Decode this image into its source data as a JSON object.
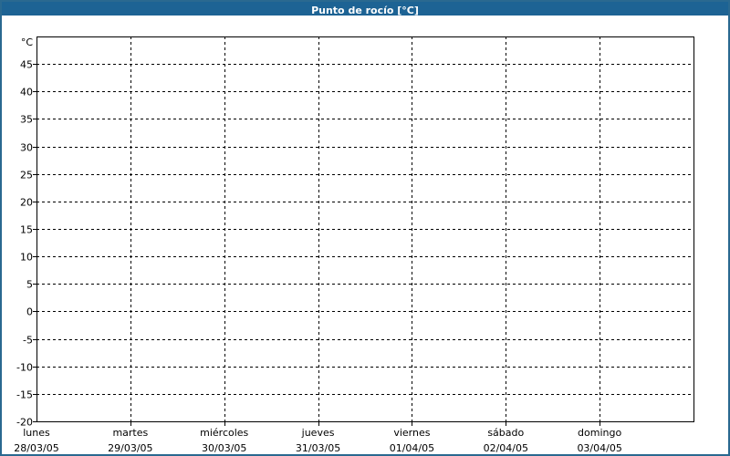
{
  "window": {
    "title": "Punto de rocío [°C]"
  },
  "chart_data": {
    "type": "line",
    "title": "Punto de rocío [°C]",
    "xlabel": "",
    "ylabel": "°C",
    "ylim": [
      -20,
      50
    ],
    "ytick_step": 5,
    "ytick_labels": [
      "45",
      "40",
      "35",
      "30",
      "25",
      "20",
      "15",
      "10",
      "5",
      "0",
      "-5",
      "-10",
      "-15",
      "-20"
    ],
    "grid": true,
    "grid_style": "dashed",
    "legend": "none",
    "x_categories": [
      {
        "day": "lunes",
        "date": "28/03/05"
      },
      {
        "day": "martes",
        "date": "29/03/05"
      },
      {
        "day": "miércoles",
        "date": "30/03/05"
      },
      {
        "day": "jueves",
        "date": "31/03/05"
      },
      {
        "day": "viernes",
        "date": "01/04/05"
      },
      {
        "day": "sábado",
        "date": "02/04/05"
      },
      {
        "day": "domingo",
        "date": "03/04/05"
      }
    ],
    "series": []
  },
  "colors": {
    "titlebar_bg": "#1d6394",
    "titlebar_text": "#ffffff",
    "frame_border": "#2a6990",
    "plot_background": "#ffffff",
    "axis": "#000000",
    "grid": "#000000",
    "label_text": "#000000"
  }
}
